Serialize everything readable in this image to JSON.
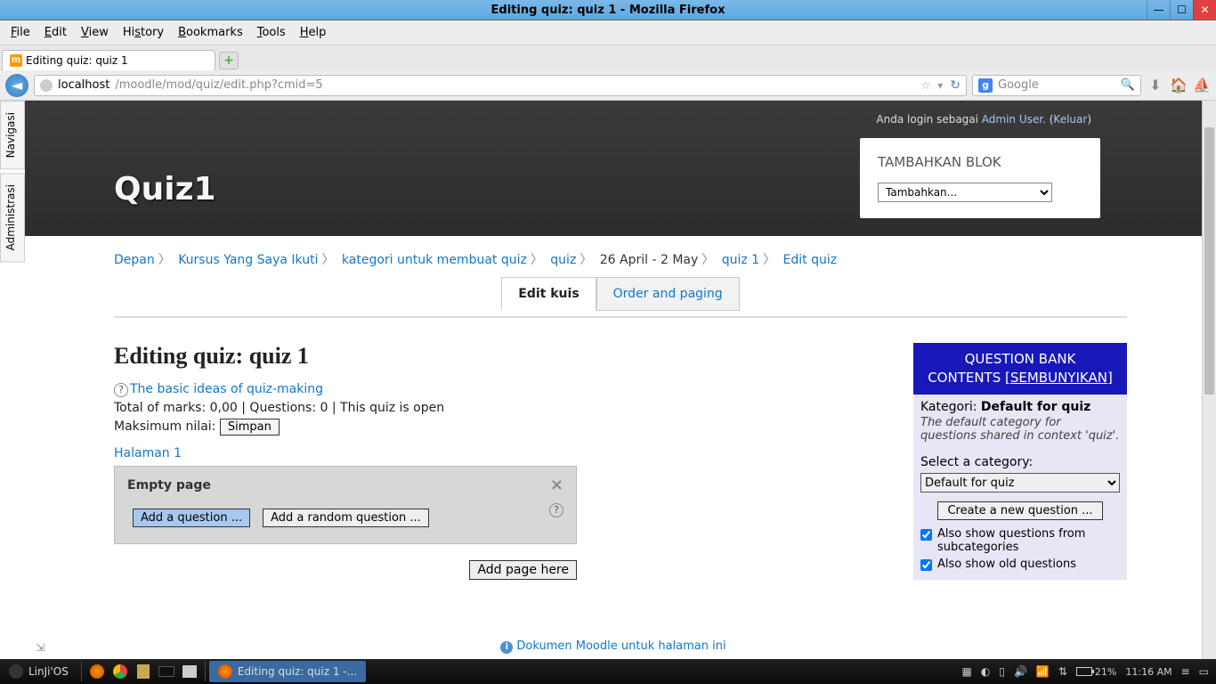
{
  "window_title": "Editing quiz: quiz 1 - Mozilla Firefox",
  "menubar": [
    "File",
    "Edit",
    "View",
    "History",
    "Bookmarks",
    "Tools",
    "Help"
  ],
  "tab_title": "Editing quiz: quiz 1",
  "url_host": "localhost",
  "url_path": "/moodle/mod/quiz/edit.php?cmid=5",
  "search_placeholder": "Google",
  "side_tabs": [
    "Navigasi",
    "Administrasi"
  ],
  "login_prefix": "Anda login sebagai ",
  "login_user": "Admin User",
  "login_sep": ". (",
  "logout": "Keluar",
  "login_close": ")",
  "page_heading": "Quiz1",
  "block_title": "TAMBAHKAN BLOK",
  "block_select": "Tambahkan...",
  "breadcrumb": {
    "items": [
      "Depan",
      "Kursus Yang Saya Ikuti",
      "kategori untuk membuat quiz",
      "quiz",
      "26 April - 2 May",
      "quiz 1",
      "Edit quiz"
    ],
    "linkflags": [
      true,
      true,
      true,
      true,
      false,
      true,
      true
    ]
  },
  "tabs": {
    "edit": "Edit kuis",
    "order": "Order and paging"
  },
  "editing_title": "Editing quiz: quiz 1",
  "help_link": "The basic ideas of quiz-making",
  "info_line": "Total of marks: 0,00 | Questions: 0 | This quiz is open",
  "max_label": "Maksimum nilai: ",
  "simpan": "Simpan",
  "page_label": "Halaman 1",
  "empty_page": "Empty page",
  "add_question": "Add a question ...",
  "add_random": "Add a random question ...",
  "add_page_here": "Add page here",
  "qbank": {
    "title1": "QUESTION BANK",
    "title2_pre": "CONTENTS [",
    "title2_hide": "SEMBUNYIKAN",
    "title2_post": "]",
    "kategori_label": "Kategori: ",
    "kategori_value": "Default for quiz",
    "desc": "The default category for questions shared in context 'quiz'.",
    "select_label": "Select a category:",
    "select_value": "Default for quiz",
    "create": "Create a new question ...",
    "chk1": "Also show questions from subcategories",
    "chk2": "Also show old questions"
  },
  "doc_link": "Dokumen Moodle untuk halaman ini",
  "taskbar": {
    "os": "LinJi'OS",
    "active": "Editing quiz: quiz 1 -...",
    "battery": "21%",
    "time": "11:16 AM"
  }
}
